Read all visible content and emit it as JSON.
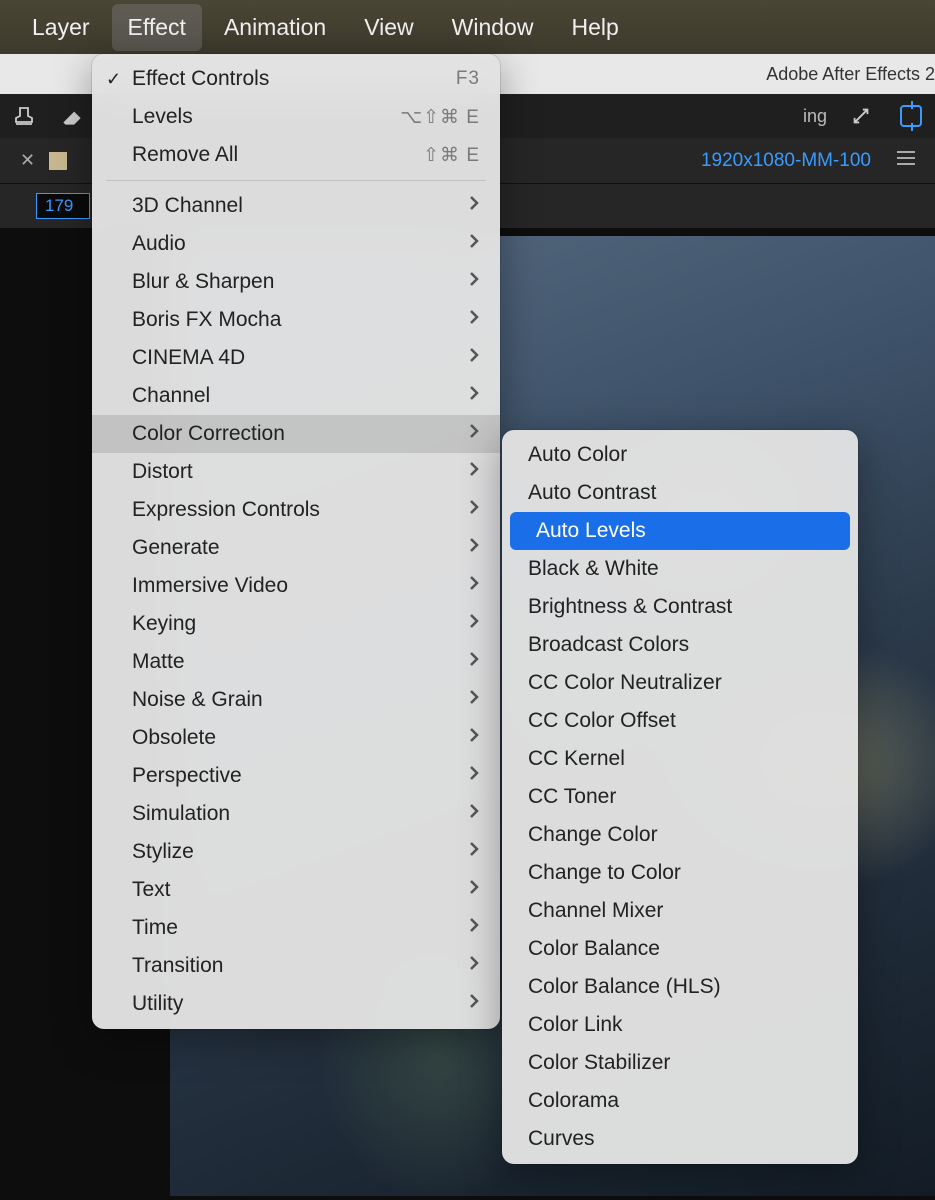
{
  "menubar": {
    "items": [
      {
        "label": "Layer",
        "active": false
      },
      {
        "label": "Effect",
        "active": true
      },
      {
        "label": "Animation",
        "active": false
      },
      {
        "label": "View",
        "active": false
      },
      {
        "label": "Window",
        "active": false
      },
      {
        "label": "Help",
        "active": false
      }
    ]
  },
  "titlebar": {
    "app": "Adobe After Effects 2"
  },
  "toolbar": {
    "ing_label": "ing"
  },
  "panel": {
    "comp_name": "1920x1080-MM-100",
    "input_value": "179"
  },
  "effect_menu": {
    "top": [
      {
        "label": "Effect Controls",
        "checked": true,
        "shortcut": "F3"
      },
      {
        "label": "Levels",
        "shortcut": "⌥⇧⌘ E"
      },
      {
        "label": "Remove All",
        "shortcut": "⇧⌘ E"
      }
    ],
    "categories": [
      {
        "label": "3D Channel"
      },
      {
        "label": "Audio"
      },
      {
        "label": "Blur & Sharpen"
      },
      {
        "label": "Boris FX Mocha"
      },
      {
        "label": "CINEMA 4D"
      },
      {
        "label": "Channel"
      },
      {
        "label": "Color Correction",
        "highlight": true
      },
      {
        "label": "Distort"
      },
      {
        "label": "Expression Controls"
      },
      {
        "label": "Generate"
      },
      {
        "label": "Immersive Video"
      },
      {
        "label": "Keying"
      },
      {
        "label": "Matte"
      },
      {
        "label": "Noise & Grain"
      },
      {
        "label": "Obsolete"
      },
      {
        "label": "Perspective"
      },
      {
        "label": "Simulation"
      },
      {
        "label": "Stylize"
      },
      {
        "label": "Text"
      },
      {
        "label": "Time"
      },
      {
        "label": "Transition"
      },
      {
        "label": "Utility"
      }
    ]
  },
  "submenu": {
    "items": [
      {
        "label": "Auto Color"
      },
      {
        "label": "Auto Contrast"
      },
      {
        "label": "Auto Levels",
        "selected": true
      },
      {
        "label": "Black & White"
      },
      {
        "label": "Brightness & Contrast"
      },
      {
        "label": "Broadcast Colors"
      },
      {
        "label": "CC Color Neutralizer"
      },
      {
        "label": "CC Color Offset"
      },
      {
        "label": "CC Kernel"
      },
      {
        "label": "CC Toner"
      },
      {
        "label": "Change Color"
      },
      {
        "label": "Change to Color"
      },
      {
        "label": "Channel Mixer"
      },
      {
        "label": "Color Balance"
      },
      {
        "label": "Color Balance (HLS)"
      },
      {
        "label": "Color Link"
      },
      {
        "label": "Color Stabilizer"
      },
      {
        "label": "Colorama"
      },
      {
        "label": "Curves"
      }
    ]
  }
}
